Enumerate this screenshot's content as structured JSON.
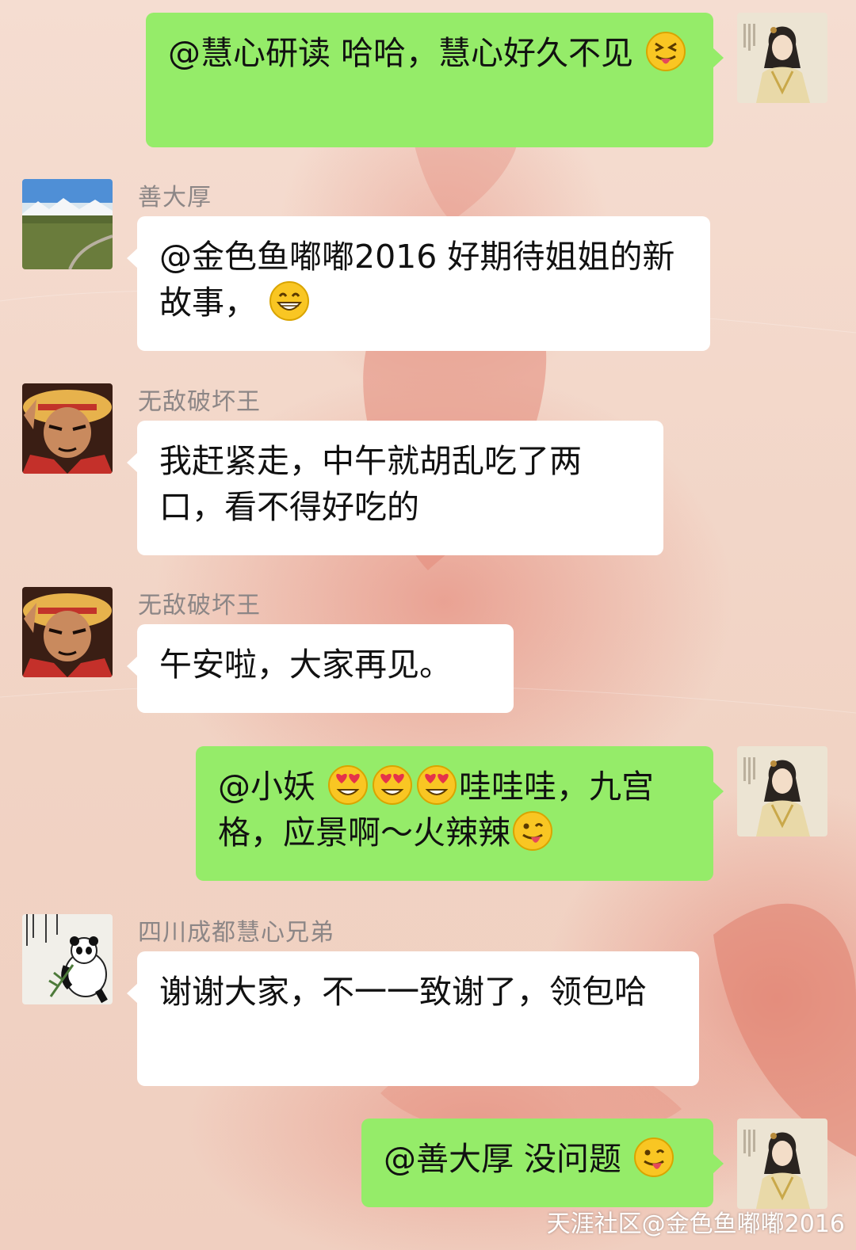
{
  "messages": [
    {
      "id": "m1",
      "direction": "out",
      "sender": "",
      "parts": [
        {
          "type": "text",
          "value": "@慧心研读 哈哈，慧心好久不见"
        },
        {
          "type": "emoji",
          "name": "squint-tongue-emoji"
        }
      ]
    },
    {
      "id": "m2",
      "direction": "in",
      "sender": "善大厚",
      "parts": [
        {
          "type": "text",
          "value": "@金色鱼嘟嘟2016 好期待姐姐的新故事，"
        },
        {
          "type": "emoji",
          "name": "grin-emoji"
        }
      ]
    },
    {
      "id": "m3",
      "direction": "in",
      "sender": "无敌破坏王",
      "parts": [
        {
          "type": "text",
          "value": "我赶紧走，中午就胡乱吃了两口，看不得好吃的"
        }
      ]
    },
    {
      "id": "m4",
      "direction": "in",
      "sender": "无敌破坏王",
      "parts": [
        {
          "type": "text",
          "value": "午安啦，大家再见。"
        }
      ]
    },
    {
      "id": "m5",
      "direction": "out",
      "sender": "",
      "parts": [
        {
          "type": "text",
          "value": "@小妖 "
        },
        {
          "type": "emoji",
          "name": "heart-eyes-emoji"
        },
        {
          "type": "emoji",
          "name": "heart-eyes-emoji"
        },
        {
          "type": "emoji",
          "name": "heart-eyes-emoji"
        },
        {
          "type": "text",
          "value": "哇哇哇，九宫格，应景啊～火辣辣"
        },
        {
          "type": "emoji",
          "name": "wink-tongue-emoji"
        }
      ]
    },
    {
      "id": "m6",
      "direction": "in",
      "sender": "四川成都慧心兄弟",
      "parts": [
        {
          "type": "text",
          "value": "谢谢大家，不一一致谢了，领包哈"
        }
      ]
    },
    {
      "id": "m7",
      "direction": "out",
      "sender": "",
      "parts": [
        {
          "type": "text",
          "value": "@善大厚 没问题"
        },
        {
          "type": "emoji",
          "name": "wink-tongue-emoji"
        }
      ]
    }
  ],
  "avatars": {
    "m1": "lady-avatar",
    "m2": "landscape-avatar",
    "m3": "straw-hat-avatar",
    "m4": "straw-hat-avatar",
    "m5": "lady-avatar",
    "m6": "panda-avatar",
    "m7": "lady-avatar"
  },
  "watermark": "天涯社区@金色鱼嘟嘟2016",
  "colors": {
    "outgoing_bubble": "#95ec69",
    "incoming_bubble": "#ffffff",
    "sender_name": "#8c8686",
    "background": "#f2d6c8"
  }
}
